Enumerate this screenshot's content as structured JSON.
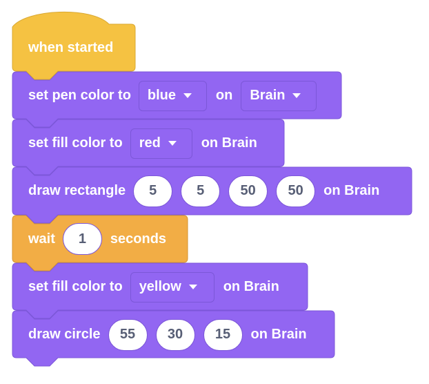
{
  "colors": {
    "looks_block": "#9266f2",
    "looks_border": "#7c57d8",
    "event_block": "#f5c242",
    "event_border": "#d9a832",
    "control_block": "#f2ad45",
    "control_border": "#d69532",
    "pill_text": "#575e75"
  },
  "blocks": [
    {
      "type": "hat",
      "category": "event",
      "text": "when started"
    },
    {
      "type": "command",
      "category": "looks",
      "parts": {
        "label": "set pen color to",
        "color": "blue",
        "on": "on",
        "target": "Brain"
      }
    },
    {
      "type": "command",
      "category": "looks",
      "parts": {
        "label": "set fill color to",
        "color": "red",
        "on_target": "on Brain"
      }
    },
    {
      "type": "command",
      "category": "looks",
      "parts": {
        "label": "draw rectangle",
        "args": [
          "5",
          "5",
          "50",
          "50"
        ],
        "on_target": "on Brain"
      }
    },
    {
      "type": "command",
      "category": "control",
      "parts": {
        "label": "wait",
        "args": [
          "1"
        ],
        "suffix": "seconds"
      }
    },
    {
      "type": "command",
      "category": "looks",
      "parts": {
        "label": "set fill color to",
        "color": "yellow",
        "on_target": "on Brain"
      }
    },
    {
      "type": "command",
      "category": "looks",
      "parts": {
        "label": "draw circle",
        "args": [
          "55",
          "30",
          "15"
        ],
        "on_target": "on Brain"
      }
    }
  ]
}
